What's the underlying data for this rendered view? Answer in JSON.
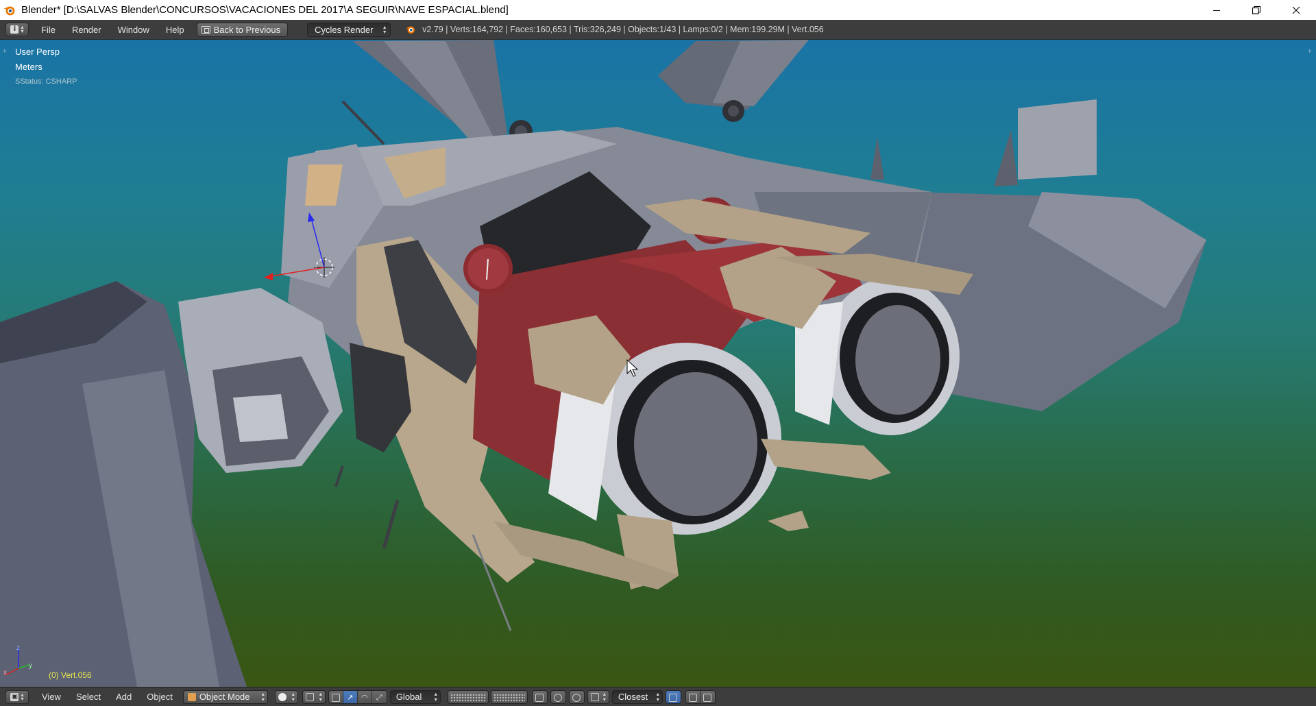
{
  "window": {
    "title": "Blender* [D:\\SALVAS Blender\\CONCURSOS\\VACACIONES DEL 2017\\A SEGUIR\\NAVE ESPACIAL.blend]",
    "controls": [
      "minimize-icon",
      "restore-icon",
      "close-icon"
    ]
  },
  "info_header": {
    "editor_icon": "info-icon",
    "menus": [
      "File",
      "Render",
      "Window",
      "Help"
    ],
    "back_button": "Back to Previous",
    "render_engine": "Cycles Render",
    "stats": "v2.79 | Verts:164,792 | Faces:160,653 | Tris:326,249 | Objects:1/43 | Lamps:0/2 | Mem:199.29M | Vert.056"
  },
  "viewport": {
    "view_name": "User Persp",
    "units": "Meters",
    "status": "SStatus: CSHARP",
    "active_object": "(0) Vert.056",
    "axis_labels": {
      "x": "x",
      "y": "y",
      "z": "z"
    }
  },
  "footer": {
    "editor_icon": "3d-view-icon",
    "menus": [
      "View",
      "Select",
      "Add",
      "Object"
    ],
    "mode": "Object Mode",
    "shading": "solid-shading-icon",
    "orientation": "Global",
    "snap_target": "Closest"
  },
  "colors": {
    "titlebar": "#ffffff",
    "header": "#3d3d3d",
    "viewport_top": "#1a73a6",
    "viewport_bottom": "#3a5612",
    "active_object_text": "#e8e850",
    "hull_grey": "#8b8f9c",
    "panel_tan": "#b3a288",
    "engine_red": "#8a2f34"
  }
}
